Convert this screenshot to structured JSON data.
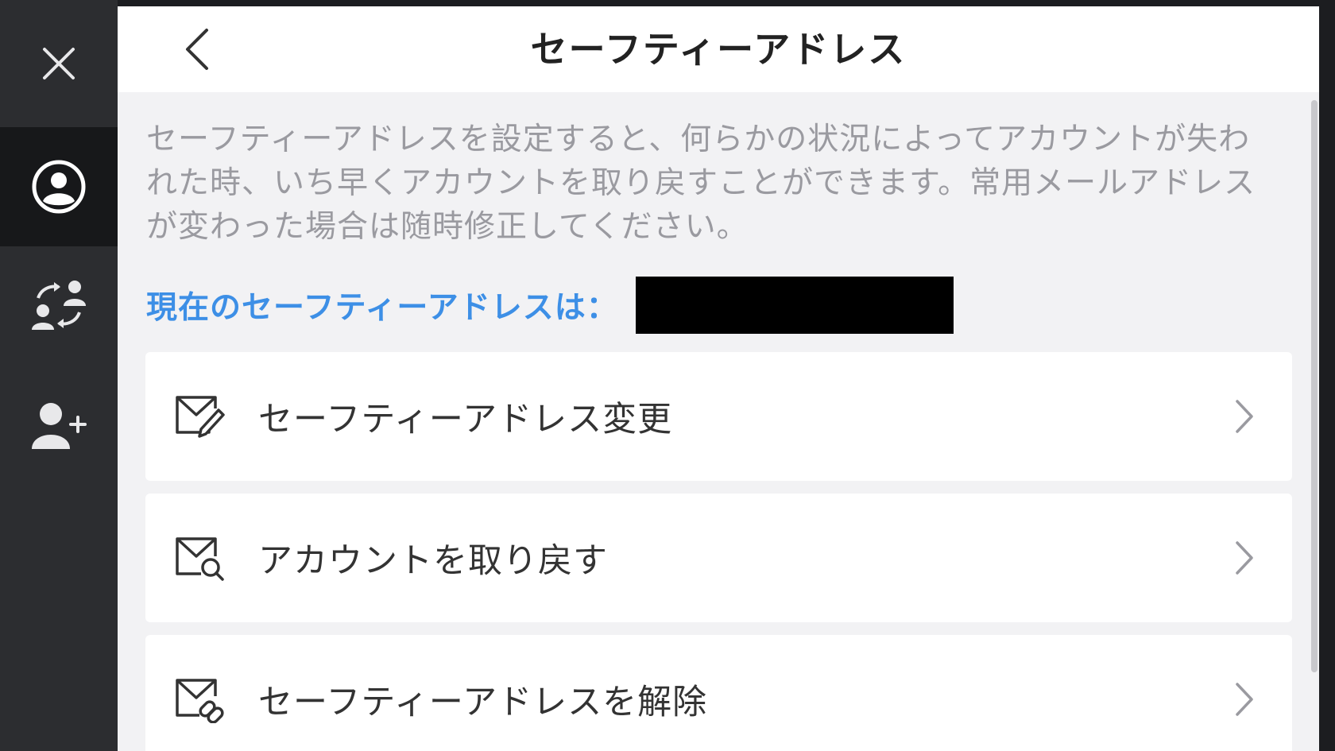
{
  "header": {
    "title": "セーフティーアドレス"
  },
  "sidebar": {
    "items": [
      {
        "icon": "close-icon"
      },
      {
        "icon": "account-circle-icon",
        "selected": true
      },
      {
        "icon": "switch-account-icon"
      },
      {
        "icon": "add-user-icon"
      }
    ]
  },
  "main": {
    "description": "セーフティーアドレスを設定すると、何らかの状況によってアカウントが失われた時、いち早くアカウントを取り戻すことができます。常用メールアドレスが変わった場合は随時修正してください。",
    "current_label": "現在のセーフティーアドレスは：",
    "menu": [
      {
        "label": "セーフティーアドレス変更",
        "icon": "mail-edit-icon"
      },
      {
        "label": "アカウントを取り戻す",
        "icon": "mail-search-icon"
      },
      {
        "label": "セーフティーアドレスを解除",
        "icon": "mail-unlink-icon"
      }
    ]
  },
  "colors": {
    "accent": "#3d8fe6",
    "sidebar_bg": "#2c2d30",
    "sidebar_selected_bg": "#17181a",
    "panel_bg": "#f2f2f4",
    "description_text": "#9a9aa0"
  }
}
